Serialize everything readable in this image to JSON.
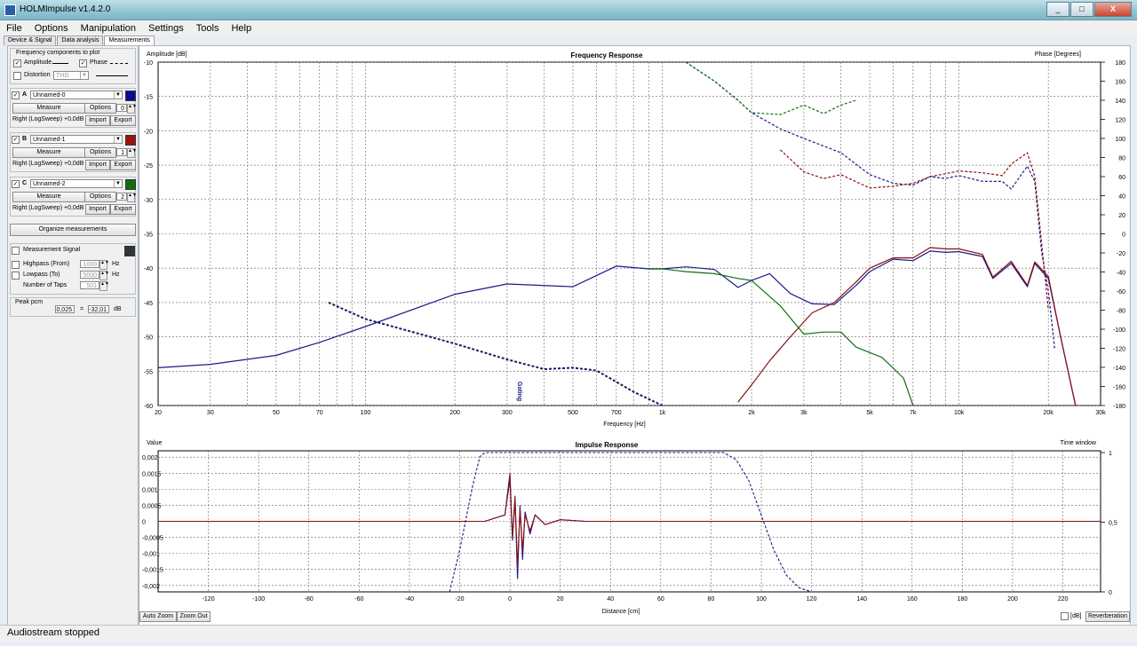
{
  "window": {
    "title": "HOLMImpulse  v1.4.2.0",
    "min": "_",
    "max": "□",
    "close": "X"
  },
  "menu": [
    "File",
    "Options",
    "Manipulation",
    "Settings",
    "Tools",
    "Help"
  ],
  "tabs": [
    "Device & Signal",
    "Data analysis",
    "Measurements"
  ],
  "left": {
    "freq_group": "Frequency components to plot",
    "amplitude": "Amplitude",
    "phase": "Phase",
    "distortion": "Distortion",
    "distortion_type": "THD",
    "measurements": [
      {
        "letter": "A",
        "name": "Unnamed-0",
        "measure": "Measure",
        "options": "Options",
        "value": "0",
        "channel": "Right (LogSweep) +0,0dB",
        "import": "Import",
        "export": "Export",
        "color": "#0a0a9a"
      },
      {
        "letter": "B",
        "name": "Unnamed-1",
        "measure": "Measure",
        "options": "Options",
        "value": "1",
        "channel": "Right (LogSweep) +0,0dB",
        "import": "Import",
        "export": "Export",
        "color": "#a01010"
      },
      {
        "letter": "C",
        "name": "Unnamed-2",
        "measure": "Measure",
        "options": "Options",
        "value": "2",
        "channel": "Right (LogSweep) +0,0dB",
        "import": "Import",
        "export": "Export",
        "color": "#107010"
      }
    ],
    "organize": "Organize measurements",
    "measurement_signal": "Measurement Signal",
    "highpass": "Highpass (From)",
    "highpass_value": "1000",
    "lowpass": "Lowpass (To)",
    "lowpass_value": "5000",
    "taps": "Number of Taps",
    "taps_value": "501",
    "hz": "Hz",
    "peak": "Peak pcm",
    "peak_value": "0,025",
    "peak_eq": "=",
    "peak_db": "-32,01",
    "db": "dB"
  },
  "freq_chart": {
    "title": "Frequency Response",
    "ylabel_left": "Amplitude [dB]",
    "ylabel_right": "Phase [Degrees]",
    "xlabel": "Frequency [Hz]",
    "xticks": [
      "20",
      "30",
      "50",
      "70",
      "100",
      "200",
      "300",
      "500",
      "700",
      "1k",
      "2k",
      "3k",
      "5k",
      "7k",
      "10k",
      "20k",
      "30k"
    ],
    "yticks_left": [
      "-10",
      "-15",
      "-20",
      "-25",
      "-30",
      "-35",
      "-40",
      "-45",
      "-50",
      "-55",
      "-60"
    ],
    "yticks_right": [
      "180",
      "160",
      "140",
      "120",
      "100",
      "80",
      "60",
      "40",
      "20",
      "0",
      "-20",
      "-40",
      "-60",
      "-80",
      "-100",
      "-120",
      "-140",
      "-160",
      "-180"
    ],
    "gating_label": "Gating"
  },
  "impulse_chart": {
    "title": "Impulse Response",
    "ylabel_left": "Value",
    "ylabel_right": "Time window",
    "xlabel": "Distance [cm]",
    "xticks": [
      "-120",
      "-100",
      "-80",
      "-60",
      "-40",
      "-20",
      "0",
      "20",
      "40",
      "60",
      "80",
      "100",
      "120",
      "140",
      "160",
      "180",
      "200",
      "220"
    ],
    "yticks_left": [
      "0,002",
      "0,0015",
      "0,001",
      "0,0005",
      "0",
      "-0,0005",
      "-0,001",
      "-0,0015",
      "-0,002"
    ],
    "yticks_right": [
      "1",
      "0,5",
      "0"
    ],
    "auto_zoom": "Auto Zoom",
    "zoom_out": "Zoom Out",
    "db_label": "[dB]",
    "reverberation": "Reverberation"
  },
  "chart_data": [
    {
      "type": "line",
      "title": "Frequency Response",
      "xlabel": "Frequency [Hz]",
      "ylabel": "Amplitude [dB]",
      "y2label": "Phase [Degrees]",
      "xscale": "log",
      "xlim": [
        20,
        30000
      ],
      "ylim": [
        -60,
        -10
      ],
      "y2lim": [
        -180,
        180
      ],
      "grid": true,
      "series": [
        {
          "axis": "amplitude",
          "color": "#1a1a8a",
          "x": [
            20,
            30,
            50,
            70,
            100,
            200,
            300,
            500,
            700,
            900,
            1000,
            1200,
            1500,
            1800,
            2000,
            2300,
            2700,
            3200,
            3800,
            4500,
            5000,
            6000,
            7000,
            8000,
            9000,
            10000,
            12000,
            13000,
            15000,
            17000,
            18000,
            20000,
            22000,
            25000
          ],
          "y": [
            -54.5,
            -54,
            -52.7,
            -50.8,
            -48.5,
            -43.8,
            -42.3,
            -42.7,
            -39.7,
            -40.1,
            -40.1,
            -39.8,
            -40.2,
            -42.8,
            -41.8,
            -40.8,
            -43.7,
            -45.2,
            -45.3,
            -42.5,
            -40.5,
            -38.7,
            -38.9,
            -37.5,
            -37.7,
            -37.6,
            -38.3,
            -41.5,
            -39.3,
            -42.7,
            -39.3,
            -41.5,
            -50,
            -61
          ]
        },
        {
          "axis": "amplitude",
          "color": "#8a1010",
          "x": [
            1800,
            2000,
            2300,
            2700,
            3200,
            3800,
            4500,
            5000,
            6000,
            7000,
            8000,
            9000,
            10000,
            12000,
            13000,
            15000,
            17000,
            18000,
            20000,
            22000,
            25000
          ],
          "y": [
            -59.5,
            -57,
            -53.5,
            -50,
            -46.5,
            -45,
            -42,
            -40,
            -38.5,
            -38.5,
            -37,
            -37.2,
            -37.2,
            -38,
            -41.3,
            -39,
            -42.5,
            -39.1,
            -41.2,
            -50,
            -61
          ]
        },
        {
          "axis": "amplitude",
          "color": "#107010",
          "x": [
            900,
            1000,
            1200,
            1500,
            1800,
            2000,
            2500,
            3000,
            3500,
            4000,
            4500,
            5500,
            6500,
            7000
          ],
          "y": [
            -40.1,
            -40.1,
            -40.5,
            -40.8,
            -41.5,
            -41.8,
            -45.5,
            -49.6,
            -49.3,
            -49.3,
            -51.5,
            -53,
            -56,
            -60
          ]
        },
        {
          "axis": "amplitude",
          "color": "#1a1a6a",
          "x": [
            75,
            100,
            200,
            300,
            400,
            500,
            600,
            800,
            1000
          ],
          "y": [
            -45,
            -47.4,
            -51,
            -53.3,
            -54.7,
            -54.5,
            -54.9,
            -58,
            -60
          ]
        },
        {
          "axis": "phase",
          "color": "#1a1a8a",
          "x": [
            1200,
            1500,
            1800,
            2000,
            2500,
            3000,
            3500,
            4000,
            5000,
            6000,
            7000,
            8000,
            9000,
            10000,
            12000,
            14000,
            15000,
            17000,
            18000,
            19000,
            20000,
            21000
          ],
          "y": [
            180,
            160,
            140,
            127,
            110,
            100,
            92,
            85,
            62,
            53,
            51,
            60,
            58,
            61,
            55,
            55,
            47,
            71,
            55,
            -20,
            -60,
            -120
          ]
        },
        {
          "axis": "phase",
          "color": "#8a1010",
          "x": [
            2500,
            3000,
            3500,
            4000,
            5000,
            6000,
            7000,
            8000,
            9000,
            10000,
            12000,
            14000,
            15000,
            17000,
            18000,
            19000,
            20000
          ],
          "y": [
            88,
            65,
            58,
            62,
            48,
            50,
            53,
            60,
            63,
            66,
            64,
            61,
            73,
            85,
            60,
            -10,
            -80
          ]
        },
        {
          "axis": "phase",
          "color": "#107010",
          "x": [
            1200,
            1500,
            1800,
            2000,
            2500,
            3000,
            3500,
            4000,
            4500
          ],
          "y": [
            180,
            160,
            140,
            127,
            125,
            135,
            126,
            135,
            140
          ]
        }
      ]
    },
    {
      "type": "line",
      "title": "Impulse Response",
      "xlabel": "Distance [cm]",
      "ylabel": "Value",
      "y2label": "Time window",
      "xlim": [
        -140,
        235
      ],
      "ylim": [
        -0.0022,
        0.0022
      ],
      "y2lim": [
        0,
        1
      ],
      "grid": true,
      "series": [
        {
          "axis": "time window",
          "color": "#1a1a8a",
          "x": [
            -24,
            -20,
            -15,
            -12,
            -10,
            85,
            90,
            95,
            100,
            105,
            110,
            115,
            120
          ],
          "y": [
            0,
            0.3,
            0.75,
            0.97,
            1,
            1,
            0.95,
            0.8,
            0.55,
            0.3,
            0.12,
            0.03,
            0
          ]
        },
        {
          "axis": "value",
          "color": "#1a1a8a",
          "x": [
            -140,
            -10,
            -2,
            0,
            1,
            2,
            3,
            4,
            5,
            6,
            8,
            10,
            14,
            20,
            30,
            40,
            60,
            80,
            100,
            120,
            160,
            200,
            235
          ],
          "y": [
            0,
            0,
            0.0002,
            0.0013,
            -0.0006,
            0.0007,
            -0.0018,
            0.0005,
            -0.0012,
            0.0003,
            -0.0004,
            0.0002,
            -0.0001,
            5e-05,
            0,
            0,
            0,
            0,
            0,
            0,
            0,
            0,
            0
          ]
        },
        {
          "axis": "value",
          "color": "#8a1010",
          "x": [
            -140,
            -10,
            -2,
            0,
            1,
            2,
            3,
            4,
            5,
            6,
            8,
            10,
            14,
            20,
            30,
            40,
            235
          ],
          "y": [
            0,
            0,
            0.0002,
            0.0015,
            -0.0005,
            0.0008,
            -0.0014,
            0.0004,
            -0.0009,
            0.0002,
            -0.0003,
            0.0002,
            -0.0001,
            5e-05,
            0,
            0,
            0
          ]
        }
      ]
    }
  ]
}
